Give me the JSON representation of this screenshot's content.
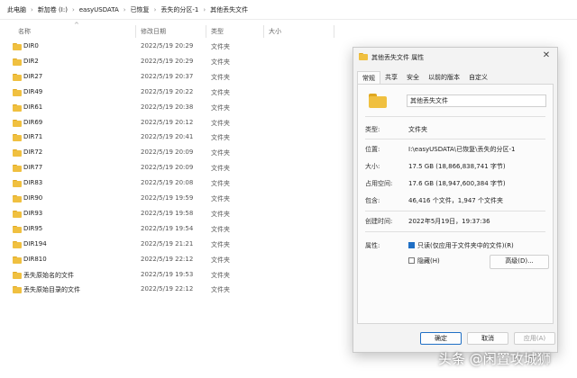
{
  "breadcrumb": [
    "此电脑",
    "新加卷 (I:)",
    "easyUSDATA",
    "已恢复",
    "丢失的分区-1",
    "其他丢失文件"
  ],
  "columns": {
    "name": "名称",
    "date": "修改日期",
    "type": "类型",
    "size": "大小"
  },
  "files": [
    {
      "name": "DIR0",
      "date": "2022/5/19 20:29",
      "type": "文件夹"
    },
    {
      "name": "DIR2",
      "date": "2022/5/19 20:29",
      "type": "文件夹"
    },
    {
      "name": "DIR27",
      "date": "2022/5/19 20:37",
      "type": "文件夹"
    },
    {
      "name": "DIR49",
      "date": "2022/5/19 20:22",
      "type": "文件夹"
    },
    {
      "name": "DIR61",
      "date": "2022/5/19 20:38",
      "type": "文件夹"
    },
    {
      "name": "DIR69",
      "date": "2022/5/19 20:12",
      "type": "文件夹"
    },
    {
      "name": "DIR71",
      "date": "2022/5/19 20:41",
      "type": "文件夹"
    },
    {
      "name": "DIR72",
      "date": "2022/5/19 20:09",
      "type": "文件夹"
    },
    {
      "name": "DIR77",
      "date": "2022/5/19 20:09",
      "type": "文件夹"
    },
    {
      "name": "DIR83",
      "date": "2022/5/19 20:08",
      "type": "文件夹"
    },
    {
      "name": "DIR90",
      "date": "2022/5/19 19:59",
      "type": "文件夹"
    },
    {
      "name": "DIR93",
      "date": "2022/5/19 19:58",
      "type": "文件夹"
    },
    {
      "name": "DIR95",
      "date": "2022/5/19 19:54",
      "type": "文件夹"
    },
    {
      "name": "DIR194",
      "date": "2022/5/19 21:21",
      "type": "文件夹"
    },
    {
      "name": "DIR810",
      "date": "2022/5/19 22:12",
      "type": "文件夹"
    },
    {
      "name": "丢失原始名的文件",
      "date": "2022/5/19 19:53",
      "type": "文件夹"
    },
    {
      "name": "丢失原始目录的文件",
      "date": "2022/5/19 22:12",
      "type": "文件夹"
    }
  ],
  "dialog": {
    "title": "其他丢失文件 属性",
    "close_icon": "close-icon",
    "tabs": [
      "常规",
      "共享",
      "安全",
      "以前的版本",
      "自定义"
    ],
    "folder_name": "其他丢失文件",
    "props": {
      "type_label": "类型:",
      "type_value": "文件夹",
      "location_label": "位置:",
      "location_value": "I:\\easyUSDATA\\已恢复\\丢失的分区-1",
      "size_label": "大小:",
      "size_value": "17.5 GB (18,866,838,741 字节)",
      "disk_label": "占用空间:",
      "disk_value": "17.6 GB (18,947,600,384 字节)",
      "contains_label": "包含:",
      "contains_value": "46,416 个文件，1,947 个文件夹",
      "created_label": "创建时间:",
      "created_value": "2022年5月19日，19:37:36",
      "attr_label": "属性:",
      "readonly_label": "只读(仅应用于文件夹中的文件)(R)",
      "hidden_label": "隐藏(H)",
      "advanced_label": "高级(D)..."
    },
    "buttons": {
      "ok": "确定",
      "cancel": "取消",
      "apply": "应用(A)"
    }
  },
  "watermark": "头条 @闲置攻城狮",
  "colors": {
    "folder": "#f0c040",
    "accent": "#1f6fc5"
  }
}
